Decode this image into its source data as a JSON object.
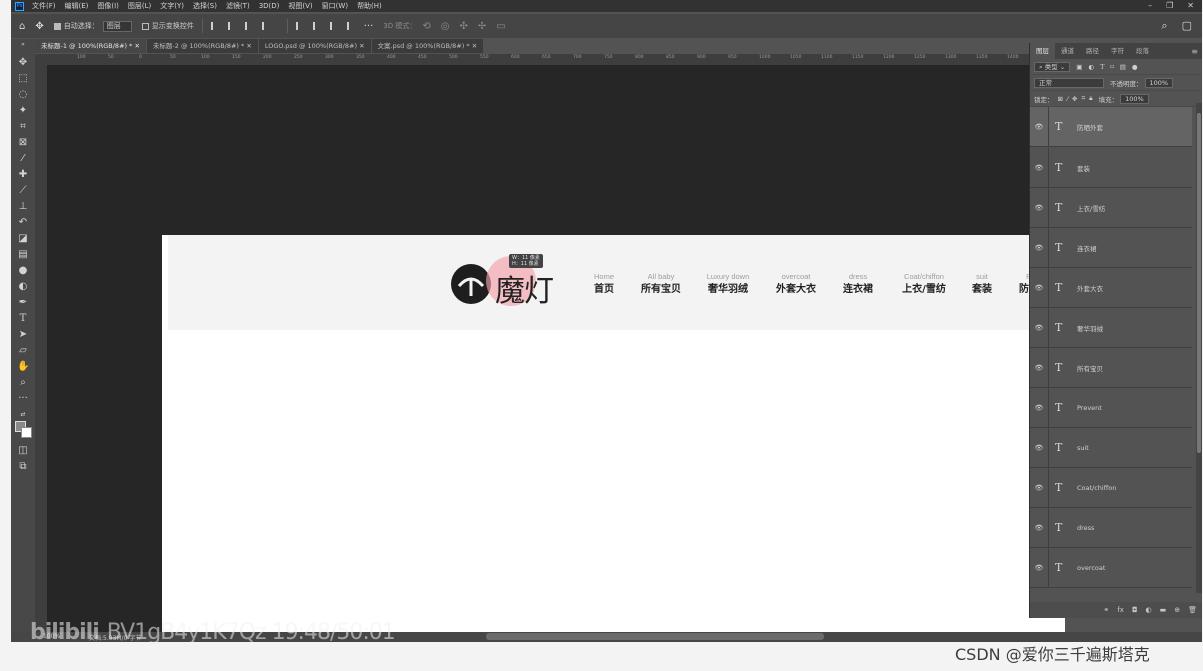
{
  "menubar": {
    "items": [
      "文件(F)",
      "编辑(E)",
      "图像(I)",
      "图层(L)",
      "文字(Y)",
      "选择(S)",
      "滤镜(T)",
      "3D(D)",
      "视图(V)",
      "窗口(W)",
      "帮助(H)"
    ]
  },
  "options": {
    "auto_select_label": "自动选择：",
    "auto_select_value": "图层",
    "show_transform_label": "显示变换控件",
    "mode_3d_label": "3D 模式："
  },
  "tabs": [
    "未标题-1 @ 100%(RGB/8#) *",
    "未标题-2 @ 100%(RGB/8#) *",
    "LOGO.psd @ 100%(RGB/8#)",
    "文案.psd @ 100%(RGB/8#) *"
  ],
  "ruler_labels": [
    "100",
    "50",
    "0",
    "50",
    "100",
    "150",
    "200",
    "250",
    "300",
    "350",
    "400",
    "450",
    "500",
    "550",
    "600",
    "650",
    "700",
    "750",
    "800",
    "850",
    "900",
    "950",
    "1000",
    "1050",
    "1100",
    "1150",
    "1200",
    "1250",
    "1300",
    "1350",
    "1400",
    "1450"
  ],
  "design": {
    "logo_text": "魔灯",
    "tooltip_w": "W：11 像素",
    "tooltip_h": "H：11 像素",
    "nav": [
      {
        "en": "Home",
        "cn": "首页"
      },
      {
        "en": "All baby",
        "cn": "所有宝贝"
      },
      {
        "en": "Luxury down",
        "cn": "奢华羽绒"
      },
      {
        "en": "overcoat",
        "cn": "外套大衣"
      },
      {
        "en": "dress",
        "cn": "连衣裙"
      },
      {
        "en": "Coat/chiffon",
        "cn": "上衣/雪纺"
      },
      {
        "en": "suit",
        "cn": "套装"
      },
      {
        "en": "Prevent",
        "cn": "防晒外套"
      }
    ]
  },
  "panel": {
    "tabs": [
      "图层",
      "通道",
      "路径",
      "字符",
      "段落"
    ],
    "filter_label": "类型",
    "blend_mode": "正常",
    "opacity_label": "不透明度：",
    "opacity_value": "100%",
    "lock_label": "锁定：",
    "fill_label": "填充：",
    "fill_value": "100%",
    "layers": [
      "防晒外套",
      "套装",
      "上衣/雪纺",
      "连衣裙",
      "外套大衣",
      "奢华羽绒",
      "所有宝贝",
      "Prevent",
      "suit",
      "Coat/chiffon",
      "dress",
      "overcoat"
    ]
  },
  "status": {
    "zoom": "100%",
    "doc": "文档:5.93M/0 字节"
  },
  "watermarks": {
    "bilibili": "bilibili",
    "video_info": "BV1gB4y1K7Qz 19:48/50:01",
    "csdn": "CSDN @爱你三千遍斯塔克"
  },
  "colors": {
    "workspace": "#262626",
    "canvas": "#ffffff",
    "header_band": "#f3f3f3",
    "accent_pink": "#f4a0aa"
  }
}
